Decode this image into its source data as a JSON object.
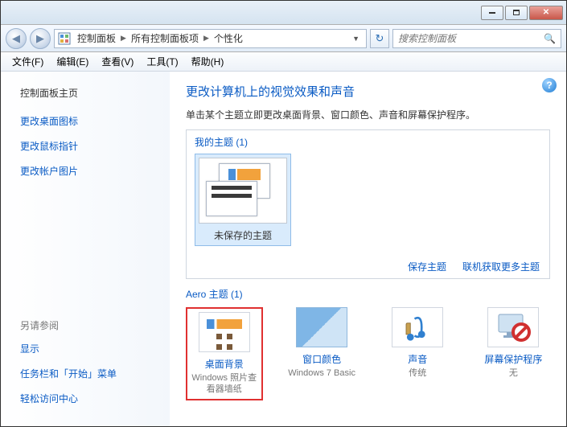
{
  "breadcrumb": {
    "root": "控制面板",
    "mid": "所有控制面板项",
    "leaf": "个性化"
  },
  "search": {
    "placeholder": "搜索控制面板"
  },
  "menu": {
    "file": "文件(F)",
    "edit": "编辑(E)",
    "view": "查看(V)",
    "tools": "工具(T)",
    "help": "帮助(H)"
  },
  "sidebar": {
    "home": "控制面板主页",
    "tasks": [
      "更改桌面图标",
      "更改鼠标指针",
      "更改帐户图片"
    ],
    "see_also_title": "另请参阅",
    "see_also": [
      "显示",
      "任务栏和「开始」菜单",
      "轻松访问中心"
    ]
  },
  "page": {
    "title": "更改计算机上的视觉效果和声音",
    "desc": "单击某个主题立即更改桌面背景、窗口颜色、声音和屏幕保护程序。"
  },
  "themes": {
    "my_label": "我的主题 (1)",
    "unsaved": "未保存的主题",
    "save": "保存主题",
    "get_more": "联机获取更多主题",
    "aero_label": "Aero 主题 (1)"
  },
  "options": {
    "bg": {
      "title": "桌面背景",
      "sub": "Windows 照片查看器墙纸"
    },
    "color": {
      "title": "窗口颜色",
      "sub": "Windows 7 Basic"
    },
    "sound": {
      "title": "声音",
      "sub": "传统"
    },
    "saver": {
      "title": "屏幕保护程序",
      "sub": "无"
    }
  }
}
